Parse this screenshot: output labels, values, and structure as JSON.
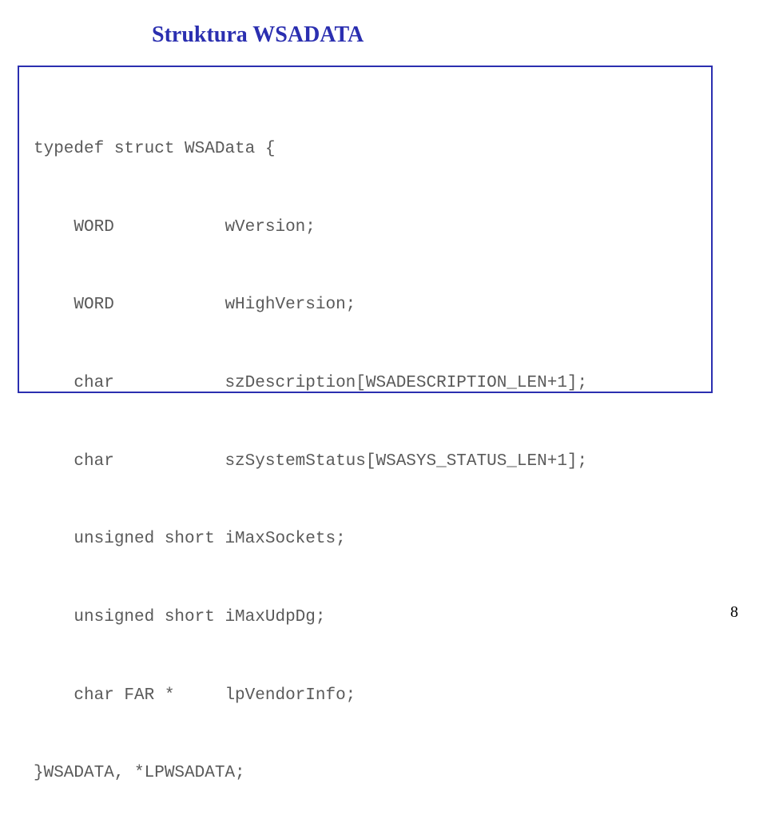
{
  "title": "Struktura WSADATA",
  "code": {
    "l1": "typedef struct WSAData {",
    "l2_type": "    WORD           ",
    "l2_name": "wVersion;",
    "l3_type": "    WORD           ",
    "l3_name": "wHighVersion;",
    "l4_type": "    char           ",
    "l4_name": "szDescription[WSADESCRIPTION_LEN+1];",
    "l5_type": "    char           ",
    "l5_name": "szSystemStatus[WSASYS_STATUS_LEN+1];",
    "l6_type": "    unsigned short ",
    "l6_name": "iMaxSockets;",
    "l7_type": "    unsigned short ",
    "l7_name": "iMaxUdpDg;",
    "l8_type": "    char FAR *     ",
    "l8_name": "lpVendorInfo;",
    "l9": "}WSADATA, *LPWSADATA;"
  },
  "page_number": "8"
}
